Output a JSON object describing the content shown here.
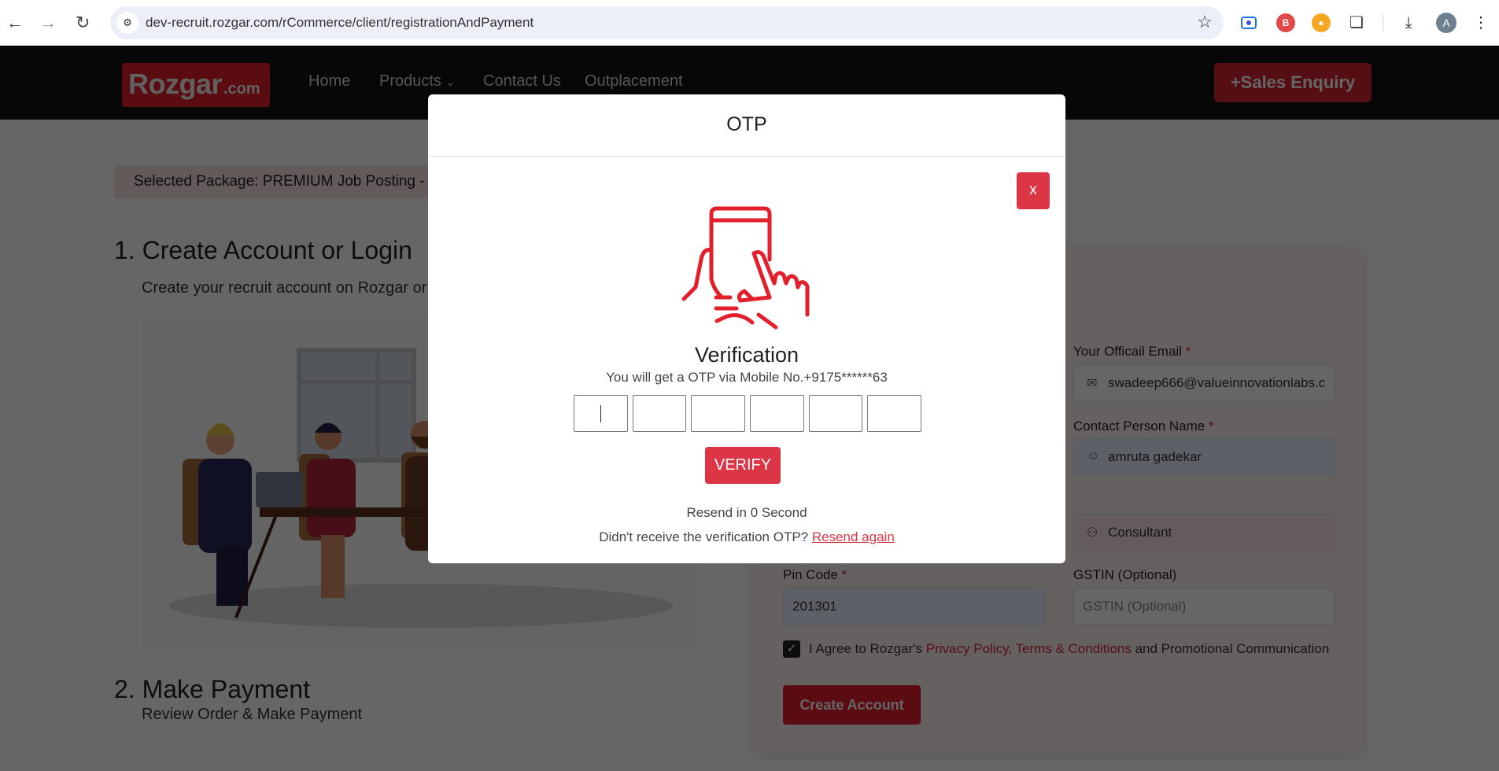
{
  "browser": {
    "url": "dev-recruit.rozgar.com/rCommerce/client/registrationAndPayment",
    "avatar_letter": "A",
    "extensions": [
      "screen-recorder-icon",
      "b-extension-icon",
      "camera-tripod-icon",
      "puzzle-extensions-icon"
    ]
  },
  "header": {
    "logo_main": "Rozgar",
    "logo_suffix": ".com",
    "nav": [
      {
        "label": "Home"
      },
      {
        "label": "Products"
      },
      {
        "label": "Contact Us"
      },
      {
        "label": "Outplacement"
      }
    ],
    "sales_enquiry_label": "+Sales Enquiry"
  },
  "page": {
    "selected_package": "Selected Package: PREMIUM Job Posting - R",
    "step1_title": "1. Create Account or Login",
    "step1_subtitle": "Create your recruit account on Rozgar or",
    "step2_title": "2. Make Payment",
    "step2_subtitle": "Review Order & Make Payment"
  },
  "form": {
    "email_label": "Your Officail Email",
    "email_value": "swadeep666@valueinnovationlabs.c",
    "contact_label": "Contact Person Name",
    "contact_value": "amruta gadekar",
    "type_value": "Consultant",
    "pincode_label": "Pin Code",
    "pincode_value": "201301",
    "gstin_label": "GSTIN (Optional)",
    "gstin_placeholder": "GSTIN (Optional)",
    "required_mark": "*",
    "agree_checked": true,
    "agree_prefix": "I Agree to Rozgar's",
    "agree_link": "Privacy Policy, Terms & Conditions",
    "agree_suffix": "and Promotional Communication",
    "create_account_label": "Create Account"
  },
  "modal": {
    "title": "OTP",
    "close_label": "x",
    "verification_title": "Verification",
    "verification_subtitle": "You will get a OTP via Mobile No.+9175******63",
    "otp_digits": [
      "",
      "",
      "",
      "",
      "",
      ""
    ],
    "verify_label": "VERIFY",
    "resend_timer": "Resend in 0 Second",
    "resend_prompt": "Didn't receive the verification OTP?",
    "resend_link": "Resend again"
  },
  "colors": {
    "brand_red": "#dc3545",
    "header_bg": "#121212"
  }
}
